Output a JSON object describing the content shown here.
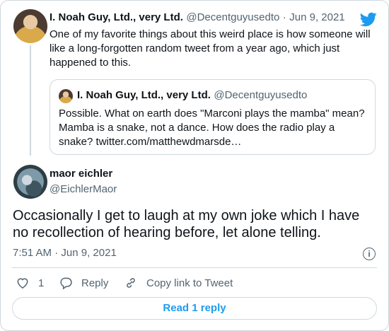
{
  "tweet": {
    "author_name": "I. Noah Guy, Ltd., very Ltd.",
    "author_handle": "@Decentguyusedto",
    "date_sep": "·",
    "date": "Jun 9, 2021",
    "text": "One of my favorite things about this weird place is how someone will like a long-forgotten random tweet from a year ago, which just happened to this.",
    "platform_icon": "twitter-bird-icon",
    "brand_color": "#1d9bf0"
  },
  "quote": {
    "author_name": "I. Noah Guy, Ltd., very Ltd.",
    "author_handle": "@Decentguyusedto",
    "text": "Possible. What on earth does \"Marconi plays the mamba\" mean? Mamba is a snake, not a dance. How does the radio play a snake? twitter.com/matthewdmarsde…"
  },
  "reply": {
    "author_name": "maor eichler",
    "author_handle": "@EichlerMaor",
    "text": "Occasionally I get to laugh at my own joke which I have no recollection of hearing before, let alone telling.",
    "time": "7:51 AM",
    "date_sep": "·",
    "date": "Jun 9, 2021",
    "info_icon": "i"
  },
  "actions": {
    "like_count": "1",
    "reply_label": "Reply",
    "copy_label": "Copy link to Tweet",
    "read_replies": "Read 1 reply"
  }
}
